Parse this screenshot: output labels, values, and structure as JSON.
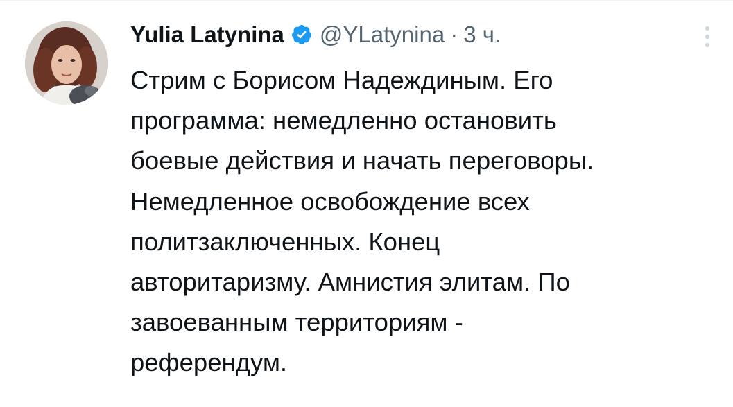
{
  "tweet": {
    "author": {
      "display_name": "Yulia Latynina",
      "verified": true,
      "verified_icon": "verified-badge-icon",
      "handle": "@YLatynina",
      "avatar_icon": "profile-photo"
    },
    "separator": "·",
    "time": "3 ч.",
    "more_icon": "more-options-icon",
    "text": "Стрим с Борисом Надеждиным. Его\nпрограмма: немедленно остановить\nбоевые действия и начать переговоры.\nНемедленное освобождение всех\nполитзаключенных. Конец\nавторитаризму. Амнистия элитам. По\nзавоеванным территориям -\nреферендум."
  },
  "colors": {
    "text_primary": "#0f1419",
    "text_secondary": "#536471",
    "verified_blue": "#1d9bf0",
    "divider": "#eff3f4"
  }
}
